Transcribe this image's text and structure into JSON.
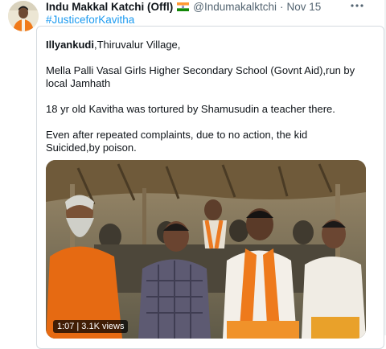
{
  "tweet": {
    "author_name": "Indu Makkal Katchi (Offl)",
    "flag_icon": "india-flag-icon",
    "handle": "@Indumakalktchi",
    "separator": "·",
    "time": "Nov 15",
    "more_icon": "more-options-icon",
    "hashtag": "#JusticeforKavitha"
  },
  "quoted": {
    "place_bold": "Illyankudi",
    "place_rest": ",Thiruvalur Village,",
    "paragraph_2": "Mella Palli Vasal Girls Higher Secondary School (Govnt Aid),run by local Jamhath",
    "paragraph_3": "18 yr old Kavitha was tortured by Shamusudin a teacher there.",
    "paragraph_4": "Even after repeated complaints, due to no action, the kid Suicided,by poison.",
    "video": {
      "duration": "1:07",
      "views": "3.1K views",
      "separator": "|"
    }
  },
  "colors": {
    "link": "#1d9bf0",
    "text": "#0f1419",
    "muted": "#536471",
    "border": "#d5dbe0"
  }
}
